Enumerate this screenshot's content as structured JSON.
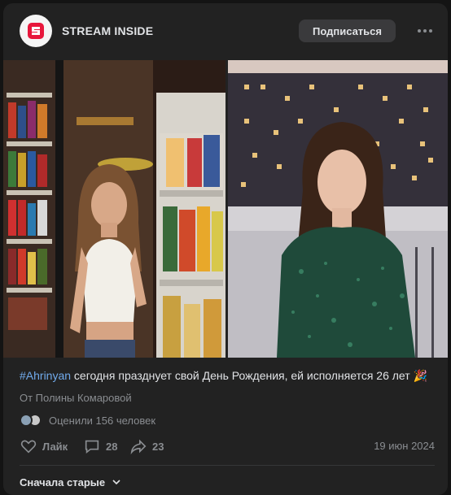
{
  "header": {
    "title": "STREAM INSIDE",
    "subscribe_label": "Подписаться"
  },
  "post": {
    "hashtag": "#Ahrinyan",
    "text": " сегодня празднует свой День Рождения, ей исполняется 26 лет 🎉",
    "author": "От Полины Комаровой",
    "likes_text": "Оценили 156 человек"
  },
  "actions": {
    "like_label": "Лайк",
    "comments_count": "28",
    "shares_count": "23",
    "date": "19 июн 2024"
  },
  "comments": {
    "sort_label": "Сначала старые"
  },
  "colors": {
    "background": "#141414",
    "card": "#222222",
    "accent_link": "#71aaeb",
    "muted": "#8a8d91",
    "logo_red": "#e8173c"
  },
  "icons": [
    "stream-inside-logo-icon",
    "more-dots-icon",
    "heart-icon",
    "comment-icon",
    "share-icon",
    "chevron-down-icon"
  ]
}
